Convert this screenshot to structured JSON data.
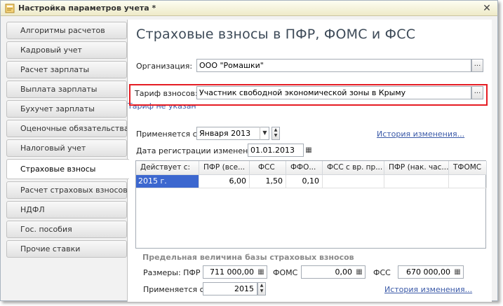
{
  "window": {
    "title": "Настройка параметров учета *",
    "close": "✕"
  },
  "sidebar": {
    "items": [
      {
        "label": "Алгоритмы расчетов"
      },
      {
        "label": "Кадровый учет"
      },
      {
        "label": "Расчет зарплаты"
      },
      {
        "label": "Выплата зарплаты"
      },
      {
        "label": "Бухучет зарплаты"
      },
      {
        "label": "Оценочные обязательства"
      },
      {
        "label": "Налоговый учет"
      },
      {
        "label": "Страховые взносы"
      },
      {
        "label": "Расчет страховых взносов"
      },
      {
        "label": "НДФЛ"
      },
      {
        "label": "Гос. пособия"
      },
      {
        "label": "Прочие ставки"
      }
    ],
    "active_index": 7
  },
  "main": {
    "title": "Страховые взносы в ПФР, ФОМС и ФСС",
    "organization_label": "Организация:",
    "organization_value": "ООО \"Ромашки\"",
    "tariff_label": "Тариф взносов:",
    "tariff_value": "Участник свободной экономической зоны в Крыму",
    "tariff_link": "Тариф не указан",
    "applies_label": "Применяется с:",
    "applies_value": "Января  2013",
    "history_link": "История изменения...",
    "registration_label": "Дата регистрации изменений:",
    "registration_value": "01.01.2013",
    "table": {
      "headers": [
        "Действует с:",
        "ПФР (все...",
        "ФСС",
        "ФФО...",
        "ФСС с вр. пр...",
        "ПФР (нак. час...",
        "ТФОМС"
      ],
      "rows": [
        [
          "2015 г.",
          "6,00",
          "1,50",
          "0,10",
          "",
          "",
          ""
        ]
      ]
    },
    "limit_section": {
      "title": "Предельная величина базы страховых взносов",
      "sizes_label": "Размеры: ПФР",
      "pfr_value": "711 000,00",
      "foms_label": "ФОМС",
      "foms_value": "0,00",
      "fss_label": "ФСС",
      "fss_value": "670 000,00",
      "applies_label": "Применяется с:",
      "applies_value": "2015",
      "history_link": "История изменения..."
    }
  },
  "icons": {
    "dots": "...",
    "calendar": "▦",
    "calc": "▦",
    "arrow_down": "▼",
    "spin_up": "▲",
    "spin_down": "▼"
  }
}
